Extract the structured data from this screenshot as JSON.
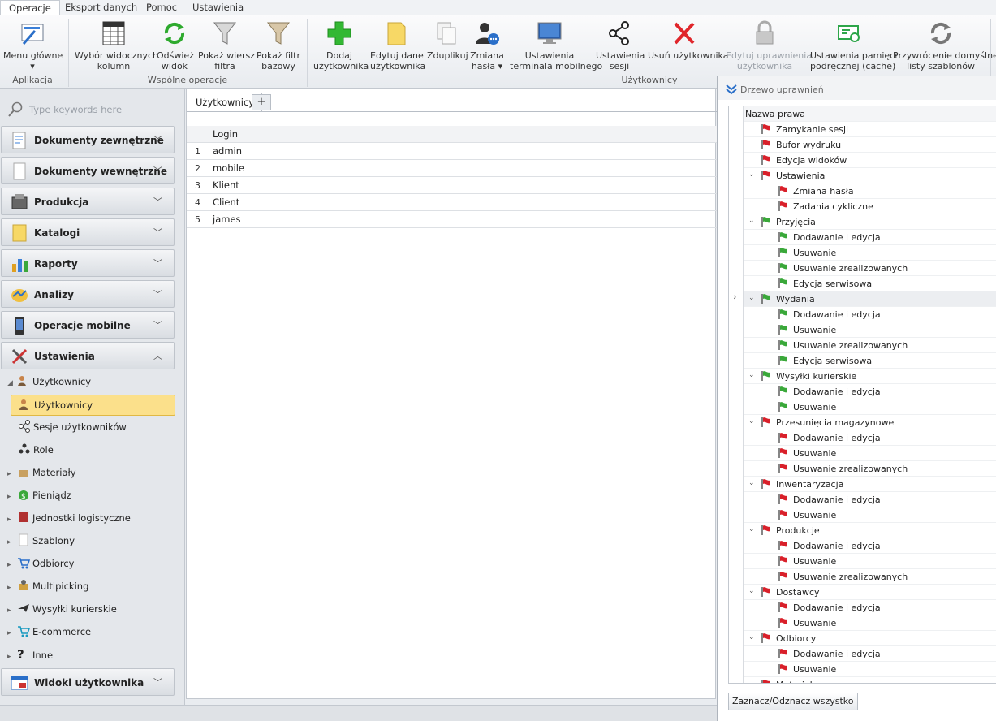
{
  "menu": {
    "tabs": [
      "Operacje",
      "Eksport danych",
      "Pomoc",
      "Ustawienia"
    ]
  },
  "ribbon": {
    "buttons": [
      {
        "label": "Menu główne",
        "label2": "▾",
        "icon": "menu-icon"
      },
      {
        "label": "Wybór widocznych",
        "label2": "kolumn",
        "icon": "columns-icon"
      },
      {
        "label": "Odśwież",
        "label2": "widok",
        "icon": "refresh-icon"
      },
      {
        "label": "Pokaż wiersz",
        "label2": "filtra",
        "icon": "filter-icon"
      },
      {
        "label": "Pokaż filtr",
        "label2": "bazowy",
        "icon": "filter-base-icon"
      },
      {
        "label": "Dodaj",
        "label2": "użytkownika",
        "icon": "add-icon"
      },
      {
        "label": "Edytuj dane",
        "label2": "użytkownika",
        "icon": "edit-icon"
      },
      {
        "label": "Zduplikuj",
        "label2": "",
        "icon": "duplicate-icon"
      },
      {
        "label": "Zmiana",
        "label2": "hasła ▾",
        "icon": "password-icon"
      },
      {
        "label": "Ustawienia",
        "label2": "terminala mobilnego",
        "icon": "terminal-icon"
      },
      {
        "label": "Ustawienia",
        "label2": "sesji",
        "icon": "session-icon"
      },
      {
        "label": "Usuń użytkownika",
        "label2": "",
        "icon": "delete-icon"
      },
      {
        "label": "Edytuj uprawnienia",
        "label2": "użytkownika",
        "icon": "lock-icon"
      },
      {
        "label": "Ustawienia pamięci",
        "label2": "podręcznej (cache)",
        "icon": "cache-icon"
      },
      {
        "label": "Przywrócenie domyślne",
        "label2": "listy szablonów",
        "icon": "restore-icon"
      }
    ],
    "groups": [
      "Aplikacja",
      "Wspólne operacje",
      "Użytkownicy"
    ]
  },
  "sidebar": {
    "search_placeholder": "Type keywords here",
    "groups": [
      "Dokumenty zewnętrzne",
      "Dokumenty wewnętrzne",
      "Produkcja",
      "Katalogi",
      "Raporty",
      "Analizy",
      "Operacje mobilne",
      "Ustawienia",
      "Widoki użytkownika"
    ],
    "items": [
      "Użytkownicy",
      "Użytkownicy",
      "Sesje użytkowników",
      "Role",
      "Materiały",
      "Pieniądz",
      "Jednostki logistyczne",
      "Szablony",
      "Odbiorcy",
      "Multipicking",
      "Wysyłki kurierskie",
      "E-commerce",
      "Inne"
    ]
  },
  "main": {
    "tab_label": "Użytkownicy",
    "add_tab": "+",
    "column_header": "Login",
    "rows": [
      {
        "n": "1",
        "login": "admin"
      },
      {
        "n": "2",
        "login": "mobile"
      },
      {
        "n": "3",
        "login": "Klient"
      },
      {
        "n": "4",
        "login": "Client"
      },
      {
        "n": "5",
        "login": "james"
      }
    ]
  },
  "rights_panel": {
    "title": "Drzewo uprawnień",
    "column_header": "Nazwa prawa",
    "button": "Zaznacz/Odznacz wszystko",
    "colors": {
      "red": "#d9202a",
      "green": "#3aa83a"
    },
    "items": [
      {
        "label": "Zamykanie sesji",
        "level": 0,
        "exp": "",
        "flag": "red"
      },
      {
        "label": "Bufor wydruku",
        "level": 0,
        "exp": "",
        "flag": "red"
      },
      {
        "label": "Edycja widoków",
        "level": 0,
        "exp": "",
        "flag": "red"
      },
      {
        "label": "Ustawienia",
        "level": 0,
        "exp": "v",
        "flag": "red"
      },
      {
        "label": "Zmiana hasła",
        "level": 1,
        "exp": "",
        "flag": "red"
      },
      {
        "label": "Zadania cykliczne",
        "level": 1,
        "exp": "",
        "flag": "red"
      },
      {
        "label": "Przyjęcia",
        "level": 0,
        "exp": "v",
        "flag": "green"
      },
      {
        "label": "Dodawanie i edycja",
        "level": 1,
        "exp": "",
        "flag": "green"
      },
      {
        "label": "Usuwanie",
        "level": 1,
        "exp": "",
        "flag": "green"
      },
      {
        "label": "Usuwanie zrealizowanych",
        "level": 1,
        "exp": "",
        "flag": "green"
      },
      {
        "label": "Edycja serwisowa",
        "level": 1,
        "exp": "",
        "flag": "green"
      },
      {
        "label": "Wydania",
        "level": 0,
        "exp": "v",
        "flag": "green",
        "hl": true
      },
      {
        "label": "Dodawanie i edycja",
        "level": 1,
        "exp": "",
        "flag": "green"
      },
      {
        "label": "Usuwanie",
        "level": 1,
        "exp": "",
        "flag": "green"
      },
      {
        "label": "Usuwanie zrealizowanych",
        "level": 1,
        "exp": "",
        "flag": "green"
      },
      {
        "label": "Edycja serwisowa",
        "level": 1,
        "exp": "",
        "flag": "green"
      },
      {
        "label": "Wysyłki kurierskie",
        "level": 0,
        "exp": "v",
        "flag": "green"
      },
      {
        "label": "Dodawanie i edycja",
        "level": 1,
        "exp": "",
        "flag": "green"
      },
      {
        "label": "Usuwanie",
        "level": 1,
        "exp": "",
        "flag": "green"
      },
      {
        "label": "Przesunięcia magazynowe",
        "level": 0,
        "exp": "v",
        "flag": "red"
      },
      {
        "label": "Dodawanie i edycja",
        "level": 1,
        "exp": "",
        "flag": "red"
      },
      {
        "label": "Usuwanie",
        "level": 1,
        "exp": "",
        "flag": "red"
      },
      {
        "label": "Usuwanie zrealizowanych",
        "level": 1,
        "exp": "",
        "flag": "red"
      },
      {
        "label": "Inwentaryzacja",
        "level": 0,
        "exp": "v",
        "flag": "red"
      },
      {
        "label": "Dodawanie i edycja",
        "level": 1,
        "exp": "",
        "flag": "red"
      },
      {
        "label": "Usuwanie",
        "level": 1,
        "exp": "",
        "flag": "red"
      },
      {
        "label": "Produkcje",
        "level": 0,
        "exp": "v",
        "flag": "red"
      },
      {
        "label": "Dodawanie i edycja",
        "level": 1,
        "exp": "",
        "flag": "red"
      },
      {
        "label": "Usuwanie",
        "level": 1,
        "exp": "",
        "flag": "red"
      },
      {
        "label": "Usuwanie zrealizowanych",
        "level": 1,
        "exp": "",
        "flag": "red"
      },
      {
        "label": "Dostawcy",
        "level": 0,
        "exp": "v",
        "flag": "red"
      },
      {
        "label": "Dodawanie i edycja",
        "level": 1,
        "exp": "",
        "flag": "red"
      },
      {
        "label": "Usuwanie",
        "level": 1,
        "exp": "",
        "flag": "red"
      },
      {
        "label": "Odbiorcy",
        "level": 0,
        "exp": "v",
        "flag": "red"
      },
      {
        "label": "Dodawanie i edycja",
        "level": 1,
        "exp": "",
        "flag": "red"
      },
      {
        "label": "Usuwanie",
        "level": 1,
        "exp": "",
        "flag": "red"
      },
      {
        "label": "Materiały",
        "level": 0,
        "exp": "v",
        "flag": "red"
      }
    ]
  }
}
